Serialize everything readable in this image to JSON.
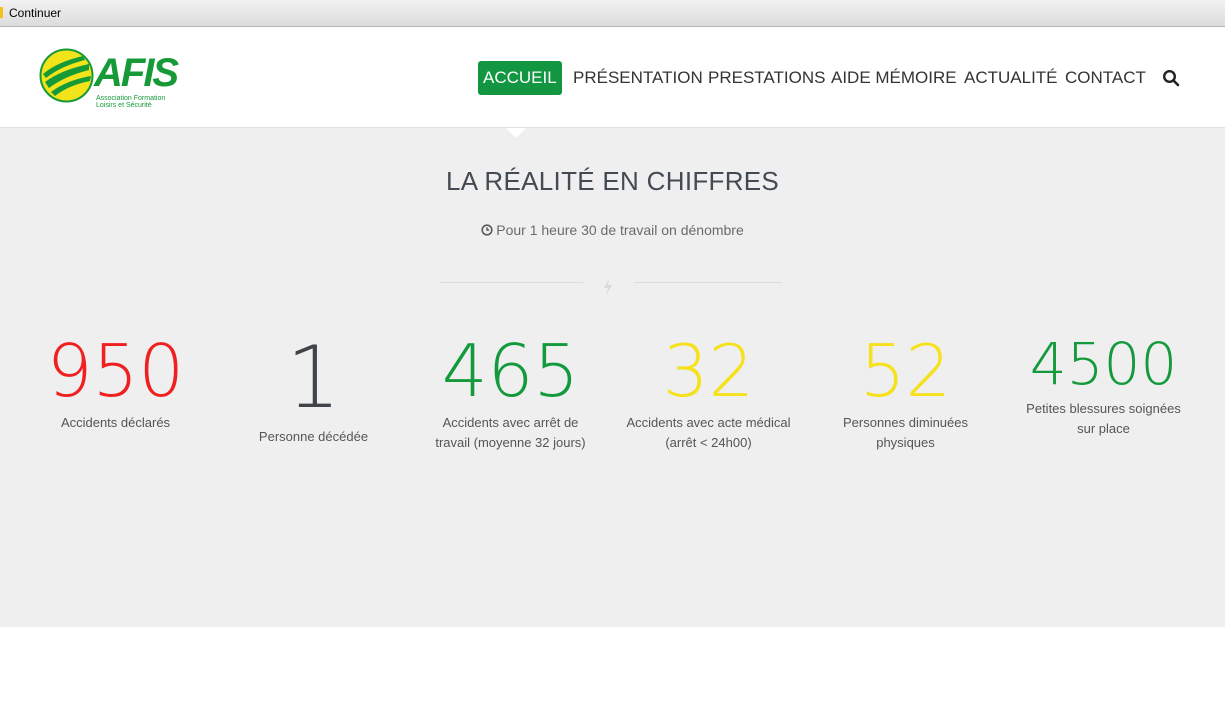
{
  "browser_bar": {
    "label": "Continuer"
  },
  "logo": {
    "brand": "AFIS",
    "tagline_line1": "Association Formation",
    "tagline_line2": "Loisirs et Sécurité"
  },
  "nav": {
    "items": [
      "ACCUEIL",
      "PRÉSENTATION",
      "PRESTATIONS",
      "AIDE MÉMOIRE",
      "ACTUALITÉ",
      "CONTACT"
    ],
    "active": "ACCUEIL",
    "search_icon": "search-icon"
  },
  "section": {
    "title": "LA RÉALITÉ EN CHIFFRES",
    "subtitle": "Pour 1 heure 30 de travail on dénombre",
    "subtitle_icon": "clock-icon",
    "divider_icon": "bolt-icon"
  },
  "stats": [
    {
      "value": "950",
      "label": "Accidents déclarés",
      "color": "#f02020"
    },
    {
      "value": "1",
      "label": "Personne décédée",
      "color": "#3f444b"
    },
    {
      "value": "465",
      "label": "Accidents avec arrêt de travail (moyenne 32 jours)",
      "color": "#149a3c"
    },
    {
      "value": "32",
      "label": "Accidents avec acte médical (arrêt < 24h00)",
      "color": "#f5e11c"
    },
    {
      "value": "52",
      "label": "Personnes diminuées physiques",
      "color": "#f5e11c"
    },
    {
      "value": "4500",
      "label": "Petites blessures soignées sur place",
      "color": "#149a3c"
    }
  ],
  "colors": {
    "accent_green": "#129641",
    "section_bg": "#efefef"
  }
}
